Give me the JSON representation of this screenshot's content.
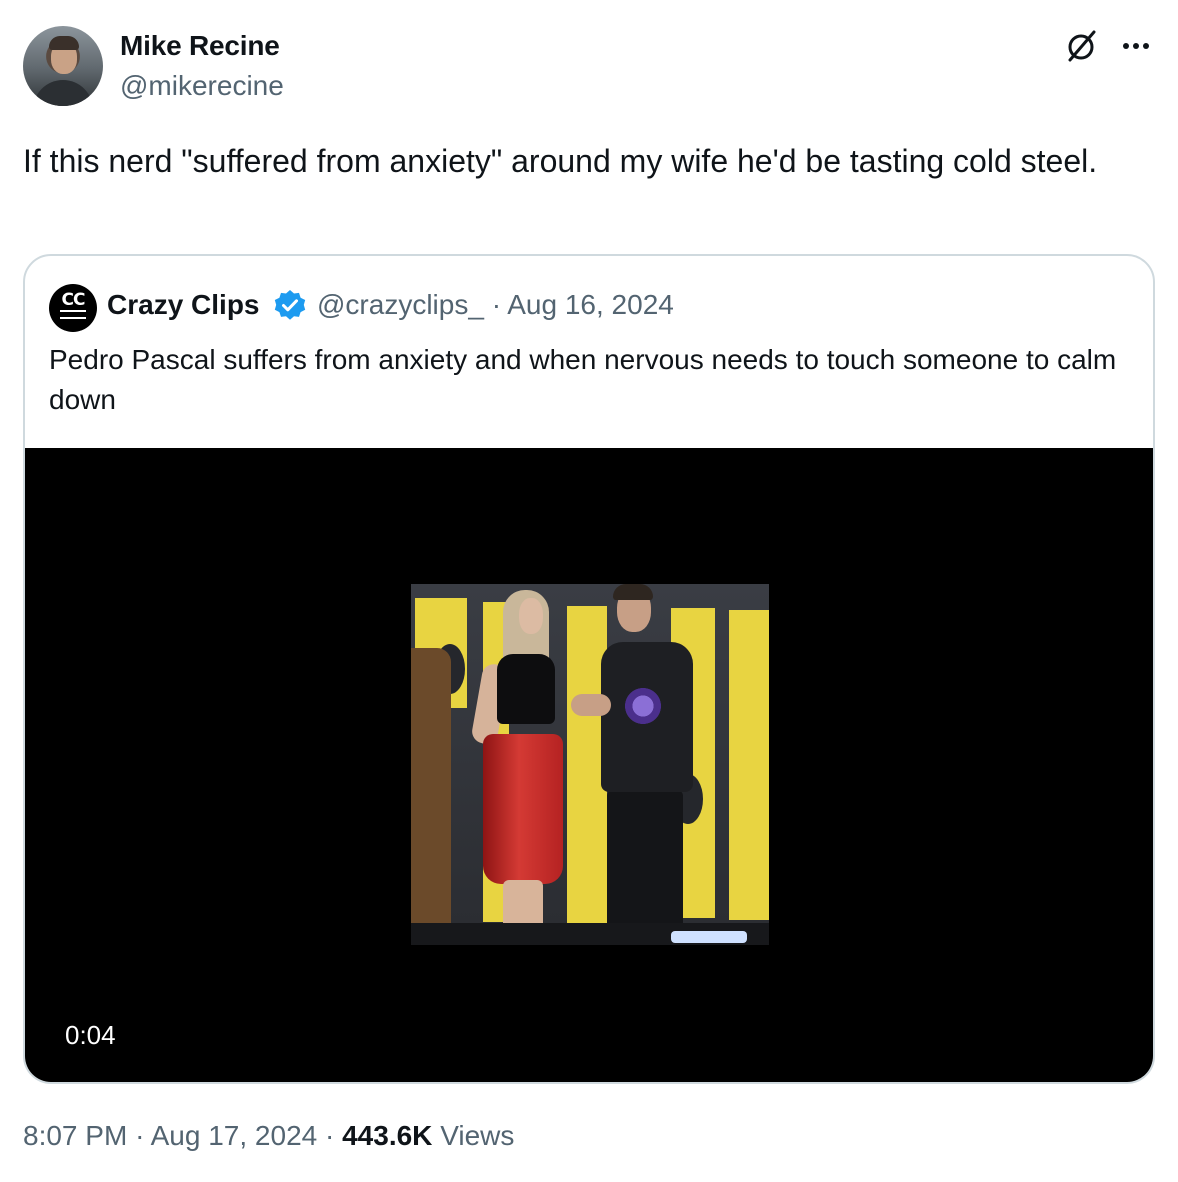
{
  "author": {
    "display_name": "Mike Recine",
    "handle": "@mikerecine"
  },
  "tweet": {
    "text": "If this nerd \"suffered from anxiety\" around my wife he'd be tasting cold steel."
  },
  "quoted_tweet": {
    "avatar_text": "CC",
    "display_name": "Crazy Clips",
    "verified": true,
    "handle": "@crazyclips_",
    "separator": "·",
    "date": "Aug 16, 2024",
    "text": "Pedro Pascal suffers from anxiety and when nervous needs to touch someone to calm down",
    "video": {
      "duration": "0:04"
    }
  },
  "footer": {
    "time": "8:07 PM",
    "separator1": "·",
    "date": "Aug 17, 2024",
    "separator2": "·",
    "views_count": "443.6K",
    "views_label": "Views"
  },
  "icons": {
    "grok": "grok-icon",
    "more": "more-icon",
    "verified": "verified-badge-icon"
  },
  "colors": {
    "text_primary": "#0f1419",
    "text_secondary": "#536471",
    "verified_blue": "#1d9bf0",
    "card_border": "#cfd9de"
  }
}
